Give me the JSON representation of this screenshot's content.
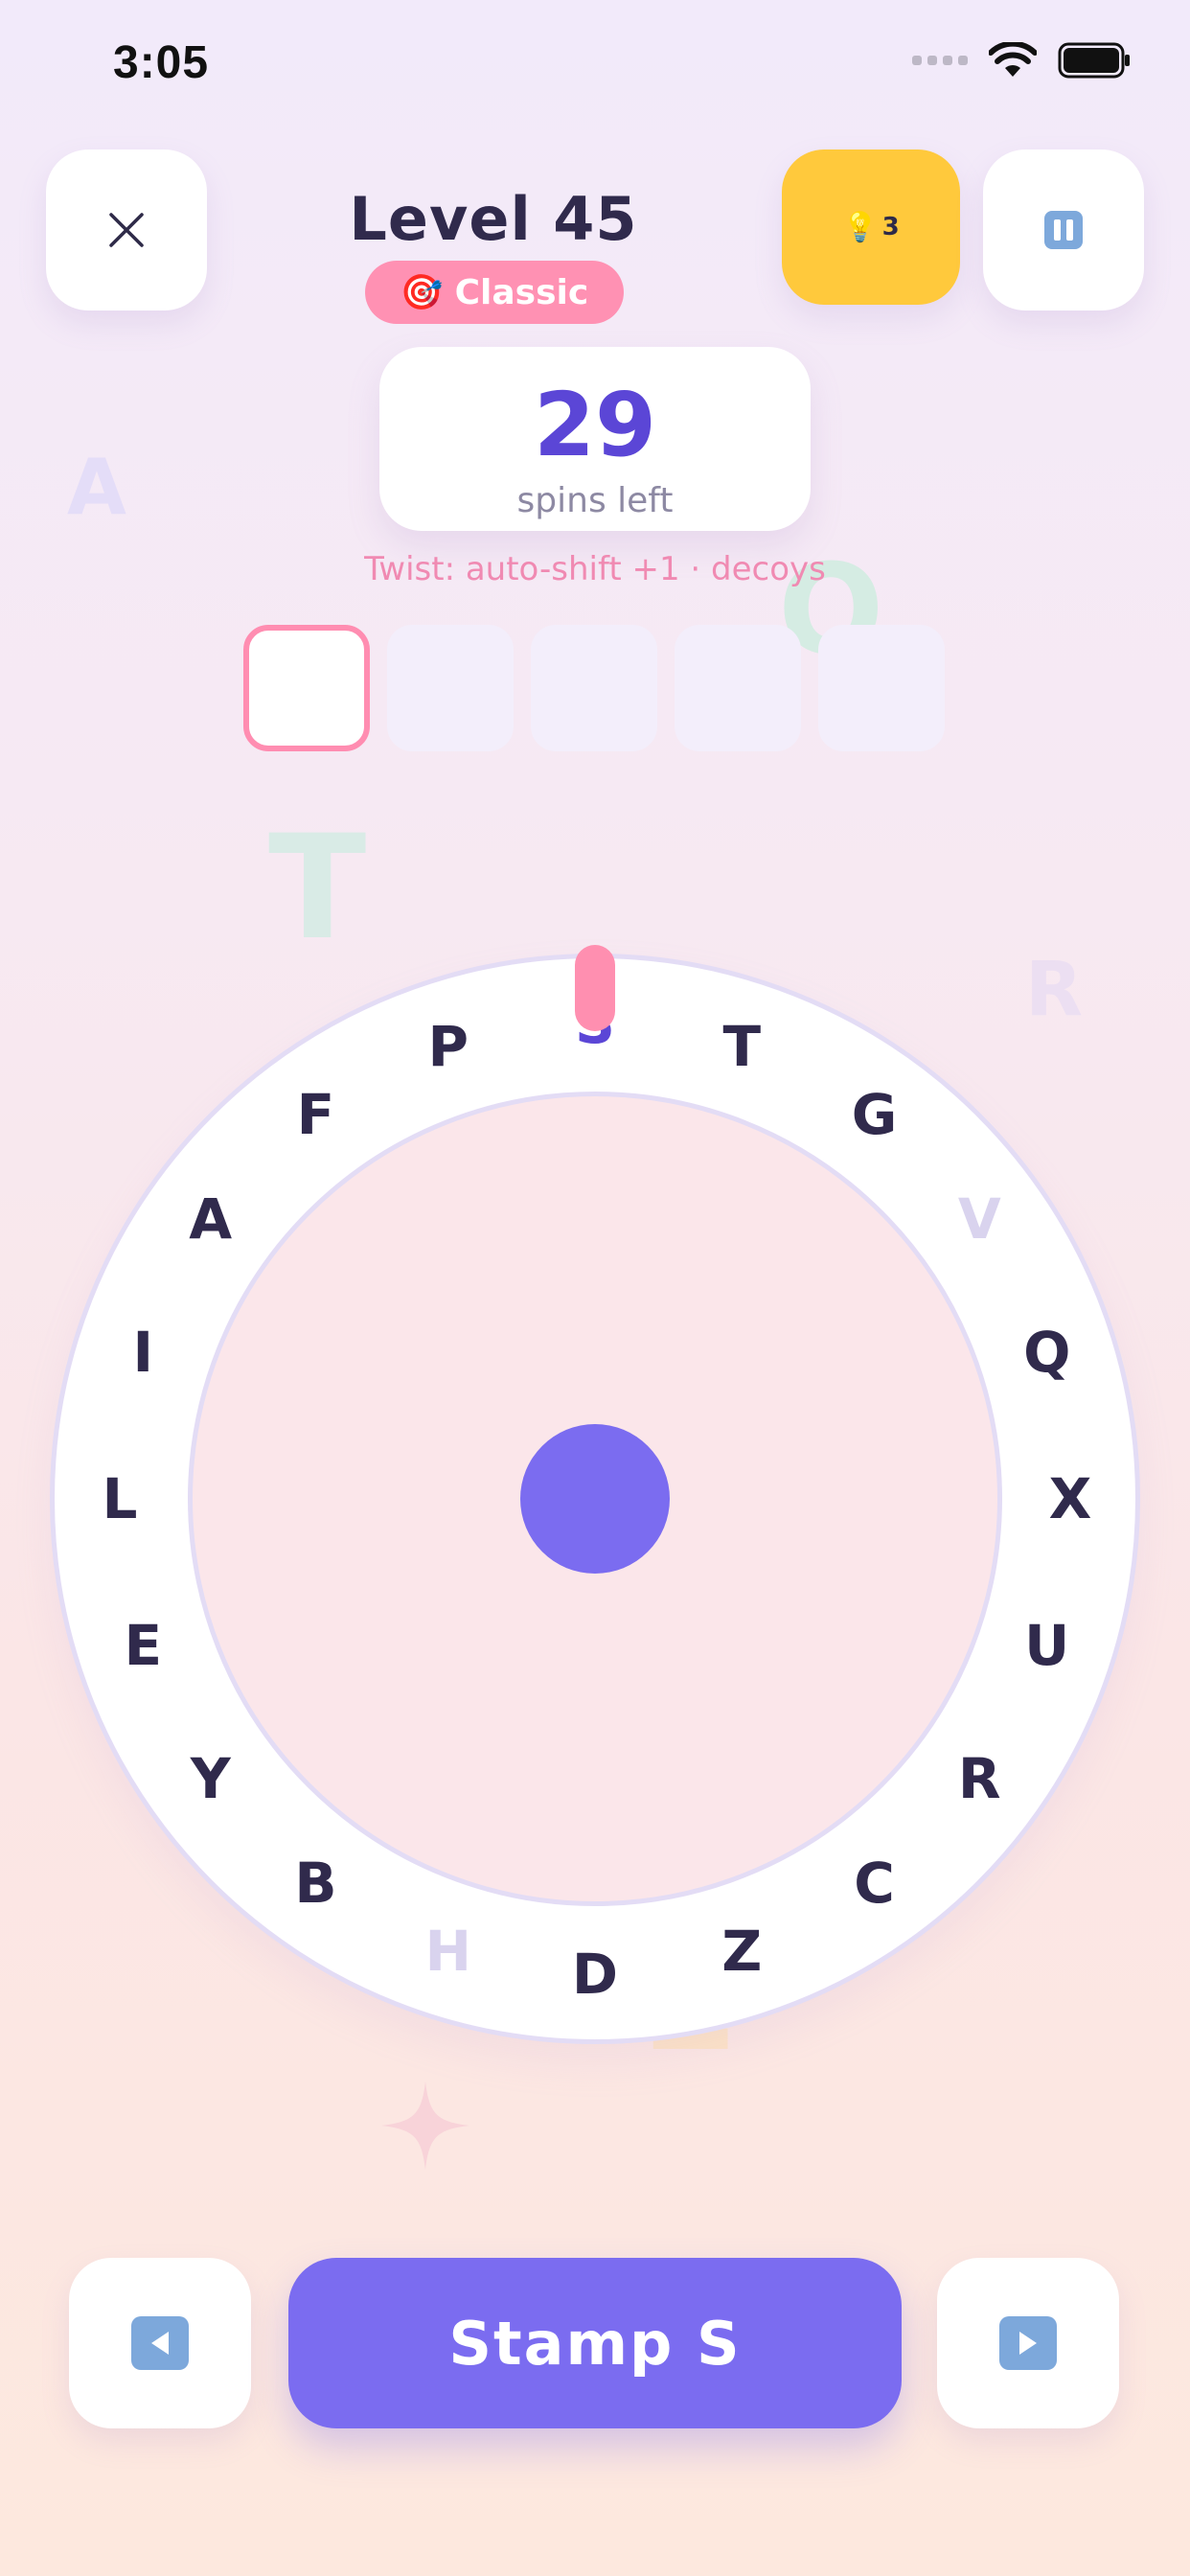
{
  "status_bar": {
    "time": "3:05"
  },
  "header": {
    "close_icon": "close-icon",
    "level_title": "Level 45",
    "mode_icon": "🎯",
    "mode_label": "Classic",
    "hint_icon": "💡",
    "hint_count": "3",
    "pause_icon": "pause-icon"
  },
  "spins": {
    "value": "29",
    "label": "spins left"
  },
  "twist_text": "Twist: auto-shift +1 · decoys",
  "answer_slots": {
    "count": 5,
    "active_index": 0,
    "letters": [
      "",
      "",
      "",
      "",
      ""
    ]
  },
  "background_letters": [
    "A",
    "O",
    "T",
    "R",
    "R",
    "L"
  ],
  "wheel": {
    "selected_letter": "S",
    "letters": [
      "S",
      "T",
      "G",
      "V",
      "Q",
      "X",
      "U",
      "R",
      "C",
      "Z",
      "D",
      "H",
      "B",
      "Y",
      "E",
      "L",
      "I",
      "A",
      "F",
      "P"
    ],
    "decoy_letters": [
      "V",
      "H"
    ]
  },
  "controls": {
    "prev_icon": "left-arrow-icon",
    "next_icon": "right-arrow-icon",
    "stamp_label": "Stamp S"
  },
  "colors": {
    "accent": "#7b6cf0",
    "pink": "#ff8fb0",
    "hint_yellow": "#ffc93c",
    "text_dark": "#302a4c"
  }
}
